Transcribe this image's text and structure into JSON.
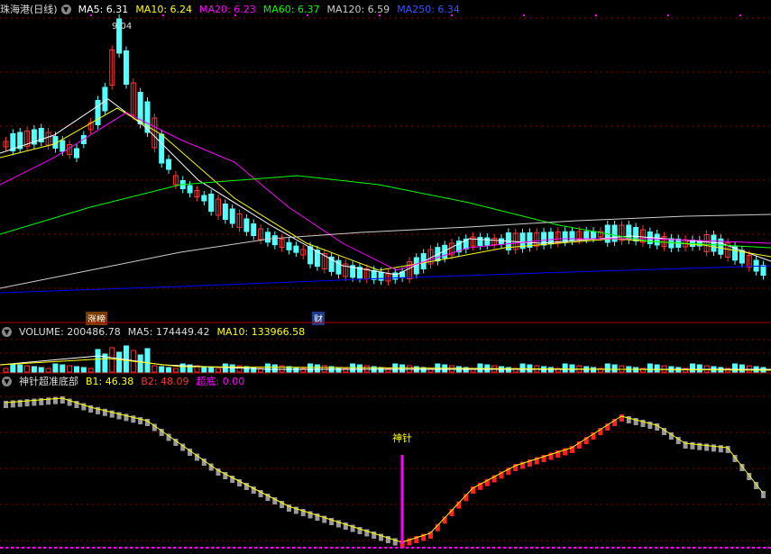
{
  "main_legend": {
    "title": "珠海港(日线)",
    "ma5": "MA5: 6.31",
    "ma10": "MA10: 6.24",
    "ma20": "MA20: 6.23",
    "ma60": "MA60: 6.37",
    "ma120": "MA120: 6.59",
    "ma250": "MA250: 6.34",
    "peak_label": "9.04"
  },
  "vol_legend": {
    "volume": "VOLUME: 200486.78",
    "ma5": "MA5: 174449.42",
    "ma10": "MA10: 133966.58"
  },
  "ind_legend": {
    "name": "神针超准底部",
    "b1": "B1: 46.38",
    "b2": "B2: 48.09",
    "chaodi": "超底: 0.00",
    "signal_label": "神针"
  },
  "tags": {
    "left": "涨榜",
    "right": "财"
  },
  "colors": {
    "ma5": "#ffffff",
    "ma10": "#ffff00",
    "ma20": "#ff00ff",
    "ma60": "#00ff00",
    "ma120": "#cccccc",
    "ma250": "#0000ff",
    "up": "#ff3333",
    "down": "#54ffff",
    "grid": "#8b0000"
  }
}
